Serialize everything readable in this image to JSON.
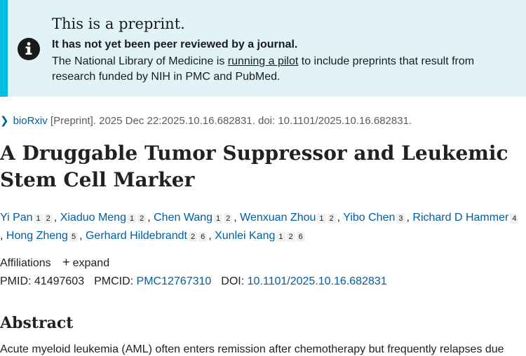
{
  "banner": {
    "title": "This is a preprint.",
    "strong": "It has not yet been peer reviewed by a journal.",
    "text_before": "The National Library of Medicine is ",
    "link": "running a pilot",
    "text_after": " to include preprints that result from research funded by NIH in PMC and PubMed.",
    "icon": "info-icon"
  },
  "citation": {
    "journal": "bioRxiv",
    "rest": " [Preprint]. 2025 Dec 22:2025.10.16.682831. doi: 10.1101/2025.10.16.682831."
  },
  "article": {
    "title": "A Druggable Tumor Suppressor and Leukemic Stem Cell Marker"
  },
  "authors": [
    {
      "name": "Yi Pan",
      "affs": [
        "1",
        "2"
      ]
    },
    {
      "name": "Xiaduo Meng",
      "affs": [
        "1",
        "2"
      ]
    },
    {
      "name": "Chen Wang",
      "affs": [
        "1",
        "2"
      ]
    },
    {
      "name": "Wenxuan Zhou",
      "affs": [
        "1",
        "2"
      ]
    },
    {
      "name": "Yibo Chen",
      "affs": [
        "3"
      ]
    },
    {
      "name": "Richard D Hammer",
      "affs": [
        "4"
      ]
    },
    {
      "name": "Hong Zheng",
      "affs": [
        "5"
      ]
    },
    {
      "name": "Gerhard Hildebrandt",
      "affs": [
        "2",
        "6"
      ]
    },
    {
      "name": "Xunlei Kang",
      "affs": [
        "1",
        "2",
        "6"
      ]
    }
  ],
  "affiliations": {
    "label": "Affiliations",
    "expand": "expand"
  },
  "ids": {
    "pmid_label": "PMID:",
    "pmid": "41497603",
    "pmcid_label": "PMCID:",
    "pmcid": "PMC12767310",
    "doi_label": "DOI:",
    "doi": "10.1101/2025.10.16.682831"
  },
  "abstract": {
    "heading": "Abstract",
    "text": "Acute myeloid leukemia (AML) often enters remission after chemotherapy but frequently relapses due"
  },
  "colors": {
    "banner_bg": "#e1f3f8",
    "banner_accent": "#00bde3",
    "link": "#005ea2"
  }
}
